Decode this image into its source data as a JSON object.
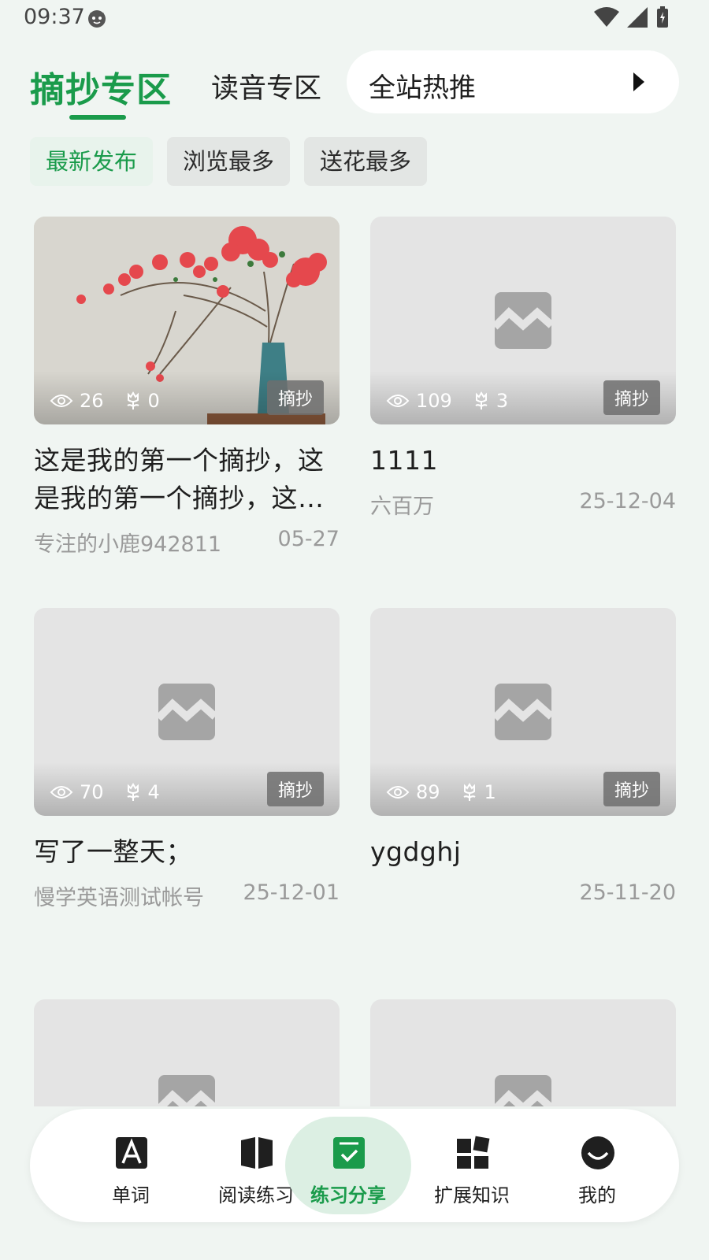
{
  "status_bar": {
    "time": "09:37"
  },
  "header": {
    "tab_primary": "摘抄专区",
    "tab_secondary": "读音专区",
    "hot_label": "全站热推"
  },
  "filters": [
    "最新发布",
    "浏览最多",
    "送花最多"
  ],
  "cards": [
    {
      "views": "26",
      "flowers": "0",
      "tag": "摘抄",
      "title": "这是我的第一个摘抄，这是我的第一个摘抄，这是我的第一个摘抄",
      "author": "专注的小鹿942811",
      "date": "05-27"
    },
    {
      "views": "109",
      "flowers": "3",
      "tag": "摘抄",
      "title": "1111",
      "author": "六百万",
      "date": "25-12-04"
    },
    {
      "views": "70",
      "flowers": "4",
      "tag": "摘抄",
      "title": "写了一整天；",
      "author": "慢学英语测试帐号",
      "date": "25-12-01"
    },
    {
      "views": "89",
      "flowers": "1",
      "tag": "摘抄",
      "title": "ygdghj",
      "author": "",
      "date": "25-11-20"
    }
  ],
  "nav": [
    {
      "label": "单词",
      "icon": "word-icon"
    },
    {
      "label": "阅读练习",
      "icon": "book-icon"
    },
    {
      "label": "练习分享",
      "icon": "share-check-icon"
    },
    {
      "label": "扩展知识",
      "icon": "blocks-icon"
    },
    {
      "label": "我的",
      "icon": "smile-icon"
    }
  ],
  "colors": {
    "accent": "#1a9b4b",
    "background": "#f0f5f2"
  }
}
